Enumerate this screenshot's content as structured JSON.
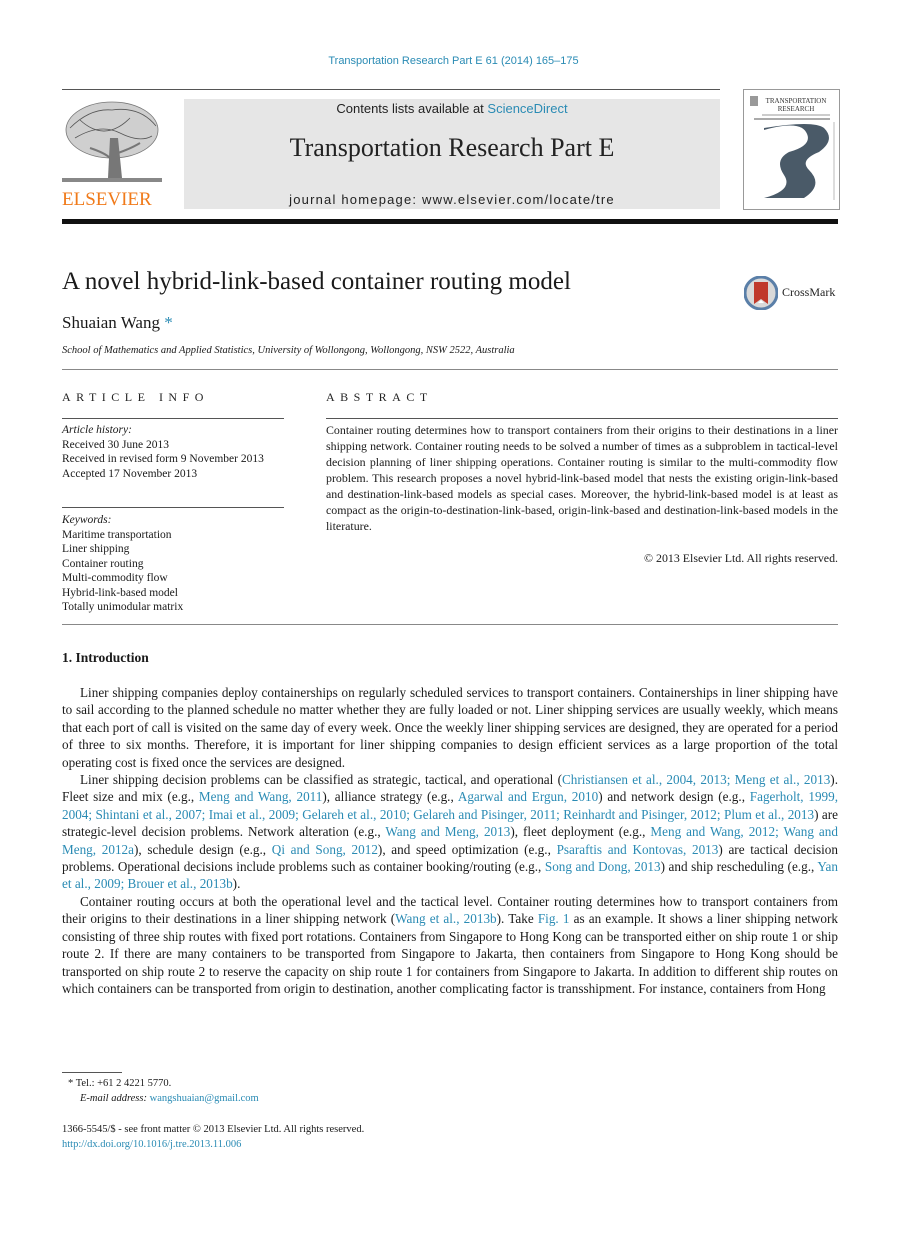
{
  "header": {
    "journal_reference": "Transportation Research Part E 61 (2014) 165–175",
    "contents_prefix": "Contents lists available at ",
    "contents_link": "ScienceDirect",
    "journal_title": "Transportation Research Part E",
    "homepage_line": "journal homepage: www.elsevier.com/locate/tre",
    "publisher_wordmark": "ELSEVIER",
    "cover_title_line1": "TRANSPORTATION",
    "cover_title_line2": "RESEARCH",
    "publisher_color": "#f07a1a",
    "link_color": "#2a8bb4"
  },
  "article": {
    "title": "A novel hybrid-link-based container routing model",
    "crossmark_label": "CrossMark",
    "author": "Shuaian Wang",
    "author_marker": "*",
    "affiliation": "School of Mathematics and Applied Statistics, University of Wollongong, Wollongong, NSW 2522, Australia"
  },
  "article_info": {
    "heading": "ARTICLE INFO",
    "history_label": "Article history:",
    "history": [
      "Received 30 June 2013",
      "Received in revised form 9 November 2013",
      "Accepted 17 November 2013"
    ],
    "keywords_label": "Keywords:",
    "keywords": [
      "Maritime transportation",
      "Liner shipping",
      "Container routing",
      "Multi-commodity flow",
      "Hybrid-link-based model",
      "Totally unimodular matrix"
    ]
  },
  "abstract": {
    "heading": "ABSTRACT",
    "text": "Container routing determines how to transport containers from their origins to their destinations in a liner shipping network. Container routing needs to be solved a number of times as a subproblem in tactical-level decision planning of liner shipping operations. Container routing is similar to the multi-commodity flow problem. This research proposes a novel hybrid-link-based model that nests the existing origin-link-based and destination-link-based models as special cases. Moreover, the hybrid-link-based model is at least as compact as the origin-to-destination-link-based, origin-link-based and destination-link-based models in the literature.",
    "copyright": "© 2013 Elsevier Ltd. All rights reserved."
  },
  "introduction": {
    "heading": "1. Introduction",
    "paragraphs": [
      [
        {
          "t": "Liner shipping companies deploy containerships on regularly scheduled services to transport containers. Containerships in liner shipping have to sail according to the planned schedule no matter whether they are fully loaded or not. Liner shipping services are usually weekly, which means that each port of call is visited on the same day of every week. Once the weekly liner shipping services are designed, they are operated for a period of three to six months. Therefore, it is important for liner shipping companies to design efficient services as a large proportion of the total operating cost is fixed once the services are designed."
        }
      ],
      [
        {
          "t": "Liner shipping decision problems can be classified as strategic, tactical, and operational ("
        },
        {
          "t": "Christiansen et al., 2004, 2013; Meng et al., 2013",
          "link": true
        },
        {
          "t": "). Fleet size and mix (e.g., "
        },
        {
          "t": "Meng and Wang, 2011",
          "link": true
        },
        {
          "t": "), alliance strategy (e.g., "
        },
        {
          "t": "Agarwal and Ergun, 2010",
          "link": true
        },
        {
          "t": ") and network design (e.g., "
        },
        {
          "t": "Fagerholt, 1999, 2004; Shintani et al., 2007; Imai et al., 2009; Gelareh et al., 2010; Gelareh and Pisinger, 2011; Reinhardt and Pisinger, 2012; Plum et al., 2013",
          "link": true
        },
        {
          "t": ") are strategic-level decision problems. Network alteration (e.g., "
        },
        {
          "t": "Wang and Meng, 2013",
          "link": true
        },
        {
          "t": "), fleet deployment (e.g., "
        },
        {
          "t": "Meng and Wang, 2012; Wang and Meng, 2012a",
          "link": true
        },
        {
          "t": "), schedule design (e.g., "
        },
        {
          "t": "Qi and Song, 2012",
          "link": true
        },
        {
          "t": "), and speed optimization (e.g., "
        },
        {
          "t": "Psaraftis and Kontovas, 2013",
          "link": true
        },
        {
          "t": ") are tactical decision problems. Operational decisions include problems such as container booking/routing (e.g., "
        },
        {
          "t": "Song and Dong, 2013",
          "link": true
        },
        {
          "t": ") and ship rescheduling (e.g., "
        },
        {
          "t": "Yan et al., 2009; Brouer et al., 2013b",
          "link": true
        },
        {
          "t": ")."
        }
      ],
      [
        {
          "t": "Container routing occurs at both the operational level and the tactical level. Container routing determines how to transport containers from their origins to their destinations in a liner shipping network ("
        },
        {
          "t": "Wang et al., 2013b",
          "link": true
        },
        {
          "t": "). Take "
        },
        {
          "t": "Fig. 1",
          "link": true
        },
        {
          "t": " as an example. It shows a liner shipping network consisting of three ship routes with fixed port rotations. Containers from Singapore to Hong Kong can be transported either on ship route 1 or ship route 2. If there are many containers to be transported from Singapore to Jakarta, then containers from Singapore to Hong Kong should be transported on ship route 2 to reserve the capacity on ship route 1 for containers from Singapore to Jakarta. In addition to different ship routes on which containers can be transported from origin to destination, another complicating factor is transshipment. For instance, containers from Hong"
        }
      ]
    ]
  },
  "footnotes": {
    "marker": "*",
    "tel": "Tel.: +61 2 4221 5770.",
    "email_label": "E-mail address:",
    "email": "wangshuaian@gmail.com",
    "front_matter": "1366-5545/$ - see front matter © 2013 Elsevier Ltd. All rights reserved.",
    "doi": "http://dx.doi.org/10.1016/j.tre.2013.11.006"
  }
}
